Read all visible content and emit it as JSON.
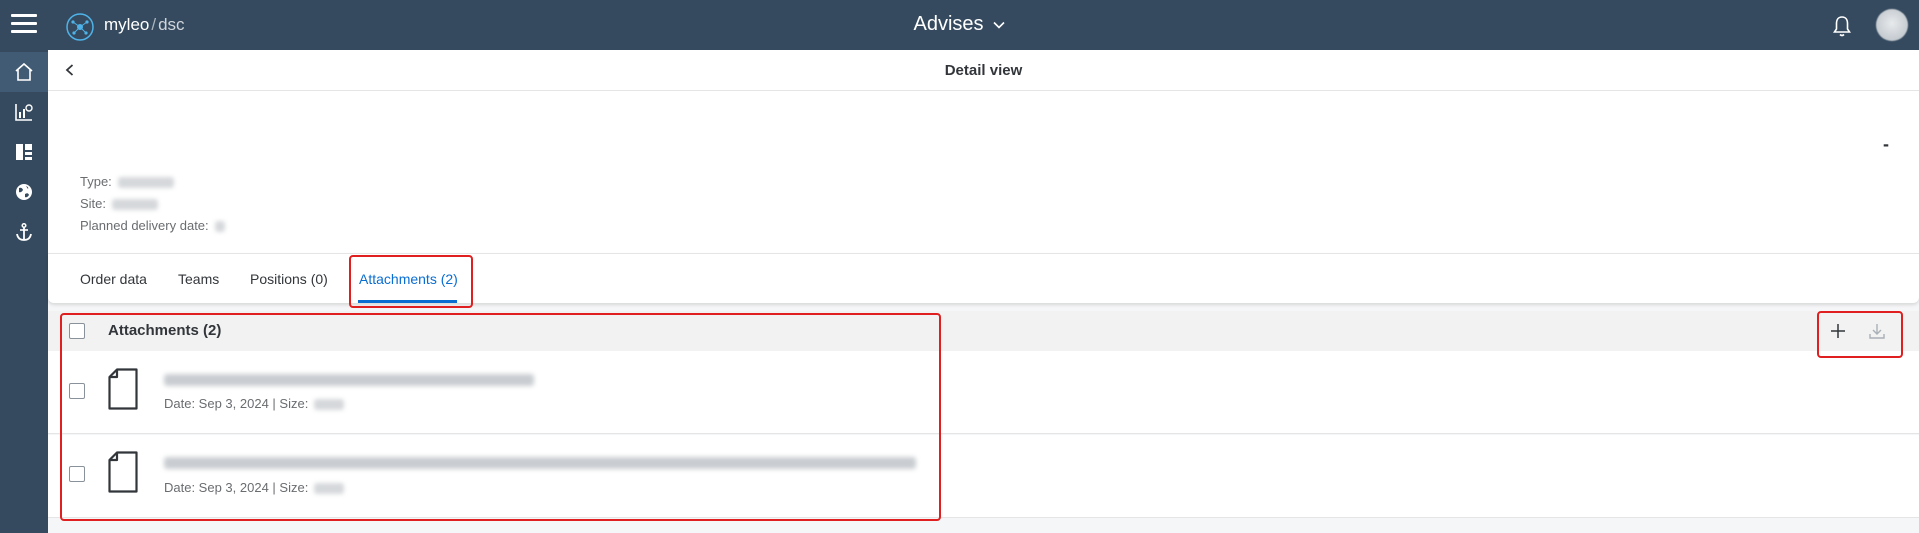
{
  "shell": {
    "brand_name": "myleo",
    "brand_separator": "/",
    "brand_suffix": "dsc",
    "app_title": "Advises"
  },
  "subheader": {
    "title": "Detail view"
  },
  "object_header": {
    "status": "-",
    "attributes": [
      {
        "label": "Type:"
      },
      {
        "label": "Site:"
      },
      {
        "label": "Planned delivery date:"
      }
    ]
  },
  "tabs": [
    {
      "label": "Order data"
    },
    {
      "label": "Teams"
    },
    {
      "label": "Positions (0)"
    },
    {
      "label": "Attachments (2)",
      "selected": true
    }
  ],
  "attachments": {
    "title": "Attachments (2)",
    "items": [
      {
        "meta_date": "Date: Sep 3, 2024 | Size:"
      },
      {
        "meta_date": "Date: Sep 3, 2024 | Size:"
      }
    ]
  },
  "colors": {
    "shell": "#354a5f",
    "accent": "#0a6ed1",
    "highlight": "#e02020"
  }
}
